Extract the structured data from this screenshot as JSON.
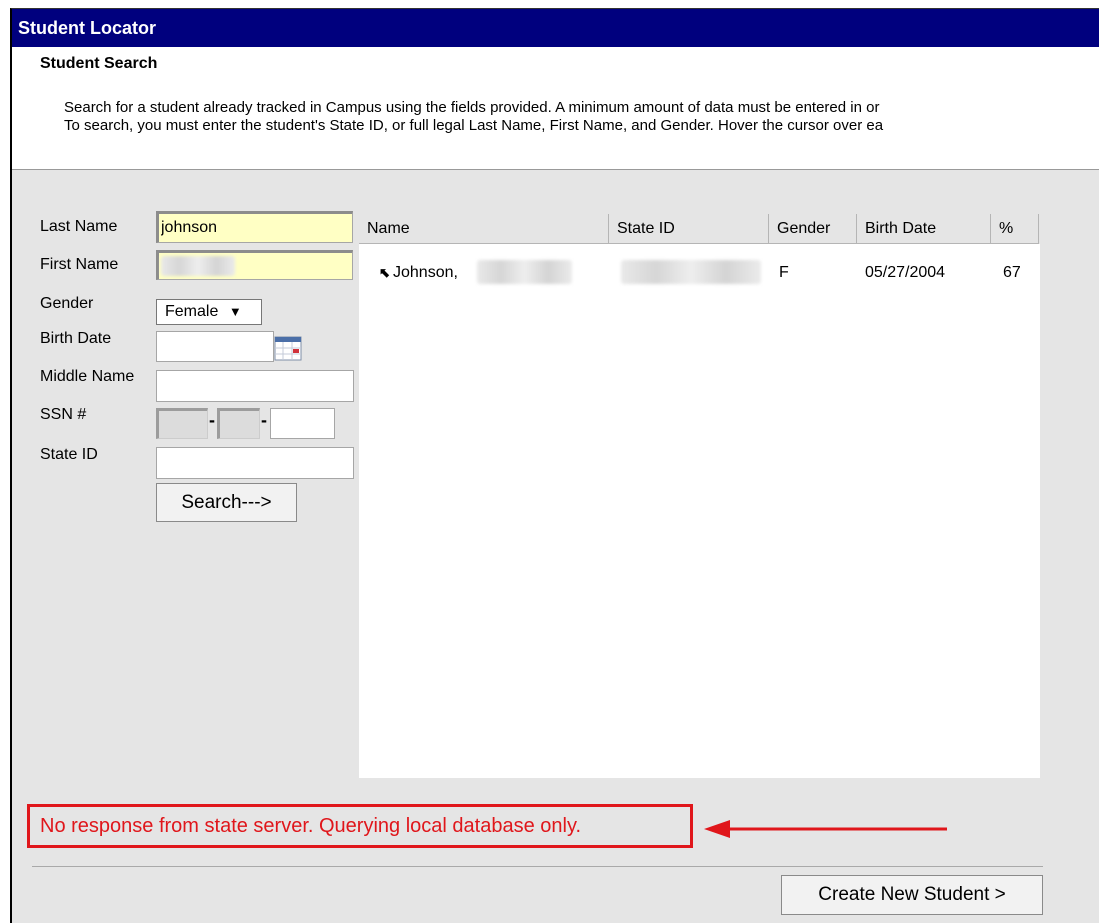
{
  "window": {
    "title": "Student Locator"
  },
  "header": {
    "heading": "Student Search",
    "desc_line1": "Search for a student already tracked in Campus using the fields provided. A minimum amount of data must be entered in or",
    "desc_line2": "To search, you must enter the student's State ID, or full legal Last Name, First Name, and Gender. Hover the cursor over ea"
  },
  "form": {
    "last_name_label": "Last Name",
    "last_name_value": "johnson",
    "first_name_label": "First Name",
    "first_name_value": "",
    "gender_label": "Gender",
    "gender_value": "Female",
    "gender_arrow": "▼",
    "birth_date_label": "Birth Date",
    "middle_name_label": "Middle Name",
    "ssn_label": "SSN #",
    "ssn_sep": "-",
    "state_id_label": "State ID",
    "search_button": "Search--->"
  },
  "results": {
    "columns": [
      "Name",
      "State ID",
      "Gender",
      "Birth Date",
      "%"
    ],
    "rows": [
      {
        "icon": "⬉",
        "name": "Johnson,",
        "gender": "F",
        "birth_date": "05/27/2004",
        "percent": "67"
      }
    ]
  },
  "status": {
    "message": "No response from state server. Querying local database only.",
    "color": "#e0161b"
  },
  "footer": {
    "create_button": "Create New Student >"
  },
  "colors": {
    "titlebar": "#00007e",
    "panel": "#e5e5e5",
    "highlight_field": "#ffffc4"
  }
}
